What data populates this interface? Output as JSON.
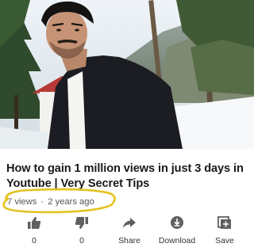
{
  "video": {
    "title": "How to gain 1 million views in just 3 days in Youtube | Very Secret Tips",
    "views": "7 views",
    "separator": "·",
    "age": "2 years ago"
  },
  "actions": [
    {
      "icon": "thumbs-up-icon",
      "label": "0"
    },
    {
      "icon": "thumbs-down-icon",
      "label": "0"
    },
    {
      "icon": "share-icon",
      "label": "Share"
    },
    {
      "icon": "download-icon",
      "label": "Download"
    },
    {
      "icon": "save-to-playlist-icon",
      "label": "Save"
    }
  ],
  "colors": {
    "annotation": "#e4c21b",
    "icon": "#606060"
  }
}
